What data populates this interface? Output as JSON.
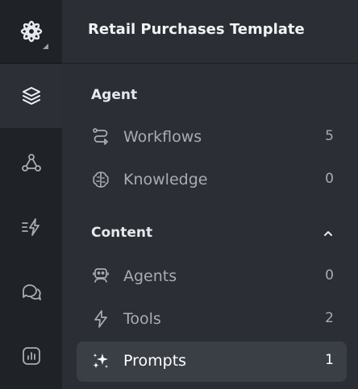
{
  "header": {
    "title": "Retail Purchases Template"
  },
  "rail": {
    "items": [
      {
        "name": "layers-icon",
        "active": true
      },
      {
        "name": "nodes-icon",
        "active": false
      },
      {
        "name": "bolt-list-icon",
        "active": false
      },
      {
        "name": "chat-icon",
        "active": false
      },
      {
        "name": "chart-icon",
        "active": false
      }
    ]
  },
  "agent": {
    "title": "Agent",
    "items": [
      {
        "label": "Workflows",
        "count": "5",
        "icon": "workflow-icon"
      },
      {
        "label": "Knowledge",
        "count": "0",
        "icon": "brain-icon"
      }
    ]
  },
  "content": {
    "title": "Content",
    "expanded": true,
    "items": [
      {
        "label": "Agents",
        "count": "0",
        "icon": "robot-icon"
      },
      {
        "label": "Tools",
        "count": "2",
        "icon": "bolt-icon"
      },
      {
        "label": "Prompts",
        "count": "1",
        "icon": "sparkles-icon",
        "active": true
      }
    ]
  },
  "colors": {
    "rail_bg": "#1f2226",
    "panel_bg": "#2b2e34",
    "active_bg": "#3a3f46",
    "muted_text": "#a7adb4"
  }
}
